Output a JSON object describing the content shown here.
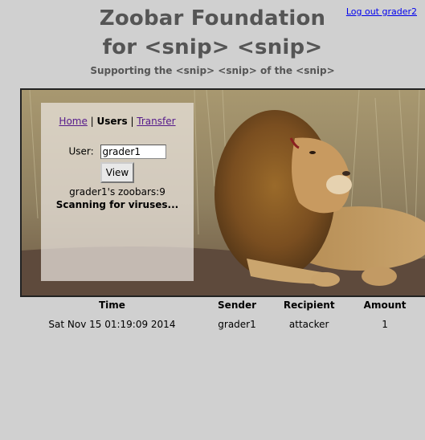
{
  "header": {
    "logout_label": "Log out grader2",
    "title_line1": "Zoobar Foundation",
    "title_line2": "for <snip> <snip>",
    "subtitle": "Supporting the <snip> <snip> of the <snip>"
  },
  "nav": {
    "home": "Home",
    "separator1": " | ",
    "users": "Users",
    "separator2": " | ",
    "transfer": "Transfer"
  },
  "users_form": {
    "user_label": "User:",
    "user_value": "grader1",
    "view_button": "View",
    "zoobars_text": "grader1's zoobars:9",
    "scanning_text": "Scanning for viruses..."
  },
  "transfers": {
    "headers": [
      "Time",
      "Sender",
      "Recipient",
      "Amount"
    ],
    "rows": [
      [
        "Sat Nov 15 01:19:09 2014",
        "grader1",
        "attacker",
        "1"
      ]
    ]
  },
  "colors": {
    "background": "#d0d0d0",
    "title": "#555555",
    "link": "#0000ee",
    "visited_link": "#551a8b"
  }
}
